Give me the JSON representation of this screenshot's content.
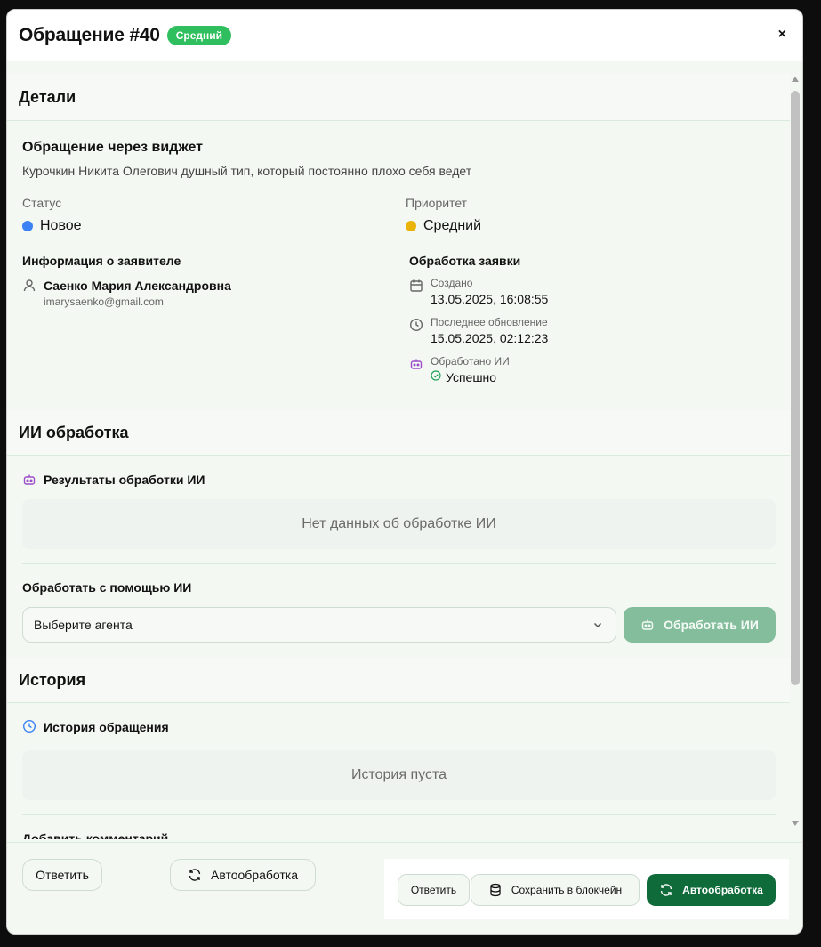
{
  "modal": {
    "title": "Обращение #40",
    "priority_badge": "Средний",
    "close_label": "×"
  },
  "details": {
    "section_title": "Детали",
    "subject": "Обращение через виджет",
    "description": "Курочкин Никита Олегович душный тип, который постоянно плохо себя ведет",
    "status_label": "Статус",
    "status_value": "Новое",
    "status_color": "#3b82f6",
    "priority_label": "Приоритет",
    "priority_value": "Средний",
    "priority_color": "#eab308",
    "applicant_title": "Информация о заявителе",
    "applicant_name": "Саенко Мария Александровна",
    "applicant_email": "imarysaenko@gmail.com",
    "processing_title": "Обработка заявки",
    "created_label": "Создано",
    "created_value": "13.05.2025, 16:08:55",
    "updated_label": "Последнее обновление",
    "updated_value": "15.05.2025, 02:12:23",
    "ai_label": "Обработано ИИ",
    "ai_value": "Успешно"
  },
  "ai": {
    "section_title": "ИИ обработка",
    "results_title": "Результаты обработки ИИ",
    "no_data": "Нет данных об обработке ИИ",
    "process_title": "Обработать с помощью ИИ",
    "select_placeholder": "Выберите агента",
    "process_button": "Обработать ИИ"
  },
  "history": {
    "section_title": "История",
    "history_title": "История обращения",
    "empty": "История пуста",
    "add_comment": "Добавить комментарий"
  },
  "footer": {
    "reply_left": "Ответить",
    "auto_left": "Автообработка",
    "reply_right": "Ответить",
    "blockchain": "Сохранить в блокчейн",
    "auto_right": "Автообработка"
  },
  "colors": {
    "accent_green": "#0f6b3a",
    "badge_green": "#2fbf5e",
    "disabled_green": "#84bd9b",
    "ai_icon_purple": "#9b4dca",
    "success_green": "#22a35a",
    "history_icon_blue": "#3b82f6"
  }
}
